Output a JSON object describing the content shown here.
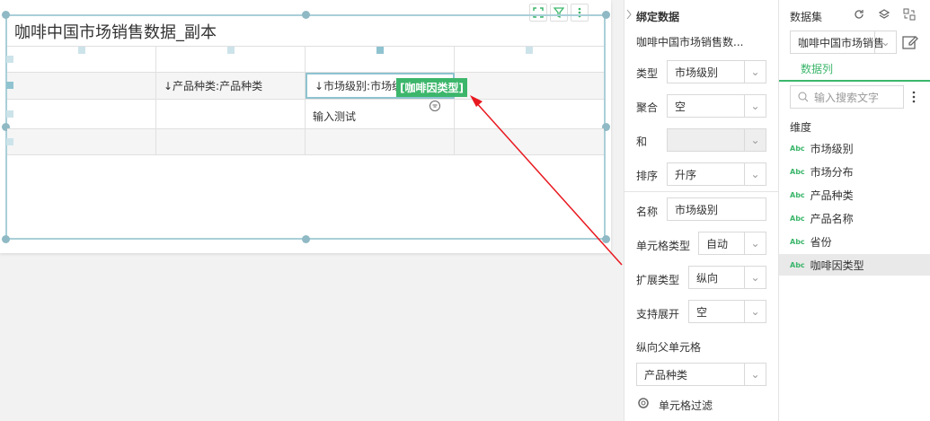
{
  "widget": {
    "title": "咖啡中国市场销售数据_副本",
    "header_row": [
      "",
      "↓产品种类:产品种类",
      "↓市场级别:市场级别",
      ""
    ],
    "row2": [
      "",
      "",
      "输入测试",
      ""
    ],
    "drag_tag": "[咖啡因类型]"
  },
  "bind_panel": {
    "heading": "绑定数据",
    "dataset_name": "咖啡中国市场销售数...",
    "type_label": "类型",
    "type_value": "市场级别",
    "agg_label": "聚合",
    "agg_value": "空",
    "sum_label": "和",
    "sum_value": "",
    "sort_label": "排序",
    "sort_value": "升序",
    "name_label": "名称",
    "name_value": "市场级别",
    "celltype_label": "单元格类型",
    "celltype_value": "自动",
    "expand_label": "扩展类型",
    "expand_value": "纵向",
    "support_label": "支持展开",
    "support_value": "空",
    "parent_label": "纵向父单元格",
    "parent_value": "产品种类",
    "filter_label": "单元格过滤"
  },
  "dataset_panel": {
    "heading": "数据集",
    "dataset_select": "咖啡中国市场销售",
    "tab": "数据列",
    "search_placeholder": "输入搜索文字",
    "group": "维度",
    "fields": [
      "市场级别",
      "市场分布",
      "产品种类",
      "产品名称",
      "省份",
      "咖啡因类型"
    ]
  },
  "colors": {
    "accent": "#3cb66b",
    "arrow": "#e8181f"
  }
}
